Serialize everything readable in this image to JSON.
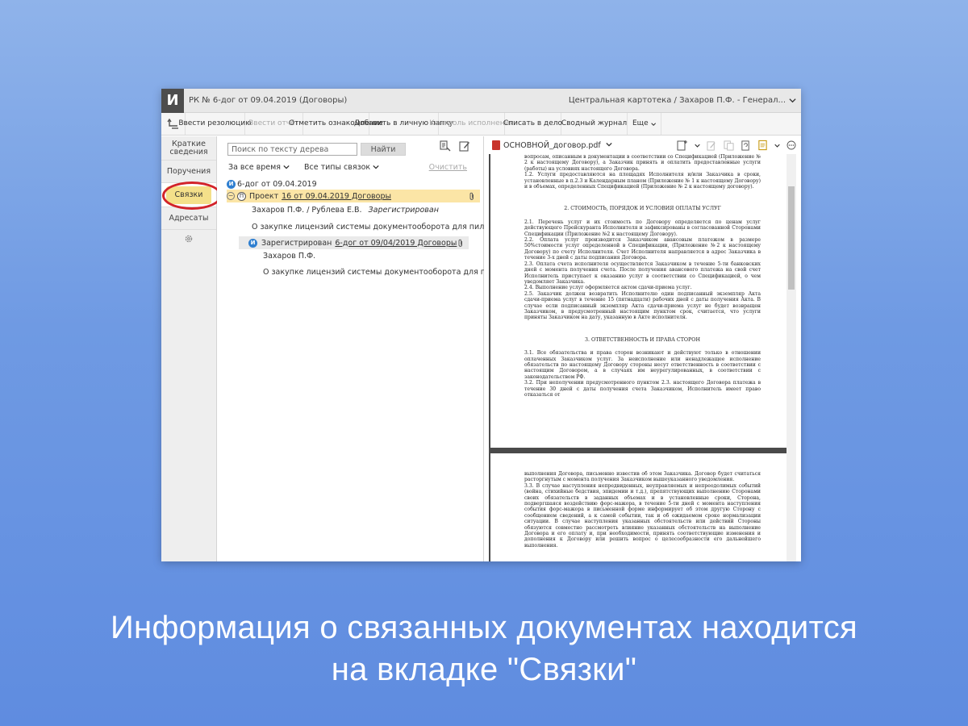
{
  "app": {
    "logo": "И",
    "title": "РК № 6-дог от 09.04.2019 (Договоры)",
    "context": "Центральная картотека / Захаров П.Ф. - Генерал..."
  },
  "toolbar": {
    "resolution": "Ввести резолюцию",
    "report": "Ввести отчёт",
    "ack": "Отметить ознакомление",
    "add_folder": "Добавить в личную папку",
    "control": "Контроль исполнения",
    "file_case": "Списать в дело",
    "journal": "Сводный журнал",
    "more": "Еще"
  },
  "sidenav": {
    "brief": "Краткие сведения",
    "tasks": "Поручения",
    "links": "Связки",
    "addressees": "Адресаты"
  },
  "tree": {
    "search_placeholder": "Поиск по тексту дерева",
    "find": "Найти",
    "filter_time": "За все время",
    "filter_types": "Все типы связок",
    "clear": "Очистить",
    "root_badge": "И",
    "root": "6-дог от 09.04.2019",
    "project_badge": "П",
    "project_prefix": "Проект",
    "project_link": "16 от 09.04.2019 Договоры",
    "project_people": "Захаров П.Ф.  /  Рублева Е.В.",
    "project_status": "Зарегистрирован",
    "project_subject": "О закупке лицензий системы документооборота для пилотног...",
    "child_badge": "И",
    "child_prefix": "Зарегистрирован",
    "child_link": "6-дог от 09/04/2019 Договоры",
    "child_person": "Захаров П.Ф.",
    "child_subject": "О закупке лицензий системы документооборота для пилот..."
  },
  "viewer": {
    "filename": "ОСНОВНОЙ_договор.pdf",
    "p1_intro": "вопросам, описанным в документации в соответствии со Спецификацией (Приложение № 2 к настоящему Договору), а Заказчик принять и оплатить предоставленные услуги (работы) на условиях настоящего Договора.",
    "p1_12": "1.2. Услуги предоставляются на площадях Исполнителя и/или Заказчика в сроки, установленные в п.2.3 и Календарным планом (Приложение № 1 к настоящему Договору) и в объемах, определенных Спецификацией (Приложение № 2 к настоящему договору).",
    "h2": "2. СТОИМОСТЬ, ПОРЯДОК И УСЛОВИЯ ОПЛАТЫ УСЛУГ",
    "p21": "2.1. Перечень услуг и их стоимость по Договору определяется по ценам услуг действующего Прейскуранта Исполнителя и зафиксированы в согласованной Сторонами Спецификации (Приложение №2 к настоящему Договору).",
    "p22": "2.2. Оплата услуг производится Заказчиком авансовым платежом в размере 50%стоимости услуг определенной в Спецификации, (Приложение №2 к настоящему Договору) по счету Исполнителя. Счет Исполнителя направляется в адрес Заказчика в течение 3-х дней с даты подписания Договора.",
    "p23": "2.3. Оплата счета исполнителя осуществляется Заказчиком в течение 5-ти банковских дней с момента получения счета. После получения авансового платежа на свой счет Исполнитель приступает к оказанию услуг в соответствии со Спецификацией, о чем уведомляет Заказчика.",
    "p24": "2.4. Выполнение услуг оформляется актом сдачи-приема услуг.",
    "p25": "2.5. Заказчик должен возвратить Исполнителю один подписанный экземпляр Акта сдачи-приема услуг в течение 15 (пятнадцати) рабочих дней с даты получения Акта. В случае если подписанный экземпляр Акта сдачи-приема услуг не будет возвращен Заказчиком, в предусмотренный настоящим пунктом срок, считается, что услуги приняты Заказчиком на дату, указанную в Акте исполнителя.",
    "h3": "3. ОТВЕТСТВЕННОСТЬ И ПРАВА СТОРОН",
    "p31": "3.1. Все обязательства и права сторон возникают и действуют только в отношении оплаченных Заказчиком услуг. За неисполнение или ненадлежащее исполнение обязательств по настоящему Договору стороны несут ответственность в соответствии с настоящим Договором, а в случаях им неурегулированных, в соответствии с законодательством РФ.",
    "p32": "3.2. При неполучении предусмотренного пунктом 2.3. настоящего Договора платежа в течение 30 дней с даты получения счета Заказчиком, Исполнитель имеет право отказаться от",
    "p2_cont": "выполнения Договора, письменно известив об этом Заказчика. Договор будет считаться расторгнутым с момента получения Заказчиком вышеуказанного уведомления.",
    "p33": "3.3. В случае наступления непредвиденных, неуправляемых и непреодолимых событий (война, стихийные бедствия, эпидемии и т.д.), препятствующих выполнению Сторонами своих обязательств в заданных объемах и в установленные сроки, Сторона, подвергшаяся воздействию форс-мажора, в течение 5-ти дней с момента наступления события форс-мажора в письменной форме информирует об этом другую Сторону с сообщением сведений, а к самой событии, так и об ожидаемом сроке нормализации ситуации. В случае наступления указанных обстоятельств или действий Стороны обязуются совместно рассмотреть влияние указанных обстоятельств на выполнение Договора и его оплату и, при необходимости, принять соответствующие изменения и дополнения к Договору или решить вопрос о целесообразности его дальнейшего выполнения."
  },
  "caption": {
    "line1": "Информация о связанных документах находится",
    "line2": "на вкладке \"Связки\""
  },
  "colors": {
    "highlight": "#f4e08a",
    "red_ring": "#d2232a",
    "badge_blue": "#2f7fd0",
    "bg_top": "#8fb3ea",
    "bg_bottom": "#5f8ce0"
  }
}
